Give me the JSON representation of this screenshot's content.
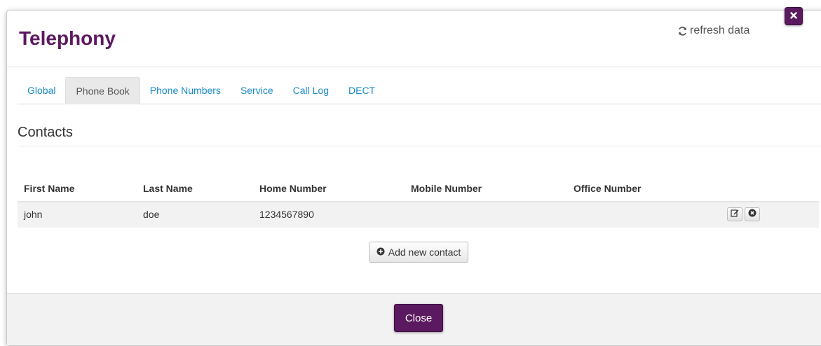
{
  "modal": {
    "title": "Telephony",
    "refresh_label": "refresh data",
    "close_x_icon": "close-icon"
  },
  "tabs": [
    {
      "label": "Global",
      "active": false
    },
    {
      "label": "Phone Book",
      "active": true
    },
    {
      "label": "Phone Numbers",
      "active": false
    },
    {
      "label": "Service",
      "active": false
    },
    {
      "label": "Call Log",
      "active": false
    },
    {
      "label": "DECT",
      "active": false
    }
  ],
  "contacts": {
    "section_title": "Contacts",
    "columns": [
      "First Name",
      "Last Name",
      "Home Number",
      "Mobile Number",
      "Office Number"
    ],
    "rows": [
      {
        "first_name": "john",
        "last_name": "doe",
        "home_number": "1234567890",
        "mobile_number": "",
        "office_number": ""
      }
    ],
    "add_label": "Add new contact"
  },
  "footer": {
    "close_label": "Close"
  },
  "colors": {
    "brand": "#5b1a5f",
    "link": "#1a8ac9",
    "active_tab_bg": "#e9e9e9",
    "row_bg": "#f2f2f2",
    "footer_bg": "#f2f2f2"
  },
  "icons": {
    "refresh": "refresh-icon",
    "close_x": "close-icon",
    "edit": "edit-icon",
    "delete": "delete-icon",
    "add": "plus-circle-icon"
  }
}
